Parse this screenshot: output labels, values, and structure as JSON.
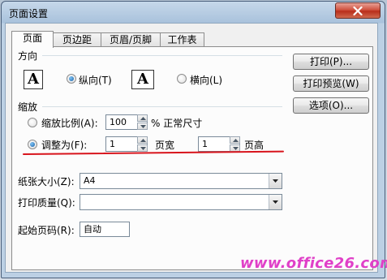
{
  "window": {
    "title": "页面设置"
  },
  "tabs": [
    {
      "label": "页面",
      "active": true
    },
    {
      "label": "页边距",
      "active": false
    },
    {
      "label": "页眉/页脚",
      "active": false
    },
    {
      "label": "工作表",
      "active": false
    }
  ],
  "orientation": {
    "section_label": "方向",
    "portrait_label": "纵向(T)",
    "landscape_label": "横向(L)",
    "icon_glyph": "A",
    "selected": "portrait"
  },
  "scaling": {
    "section_label": "缩放",
    "adjust_label": "缩放比例(A):",
    "adjust_value": "100",
    "percent_text": "% 正常尺寸",
    "fit_label": "调整为(F):",
    "fit_wide_value": "1",
    "fit_wide_label": "页宽",
    "fit_tall_value": "1",
    "fit_tall_label": "页高",
    "selected": "fit"
  },
  "paper_size": {
    "label": "纸张大小(Z):",
    "value": "A4"
  },
  "print_quality": {
    "label": "打印质量(Q):",
    "value": ""
  },
  "first_page": {
    "label": "起始页码(R):",
    "value": "自动"
  },
  "buttons": {
    "print": "打印(P)...",
    "preview": "打印预览(W)",
    "options": "选项(O)..."
  },
  "watermark": "www.office26.com",
  "colors": {
    "annotation_line": "#d8141c",
    "watermark": "#e040c8",
    "close_button": "#c8402a"
  }
}
